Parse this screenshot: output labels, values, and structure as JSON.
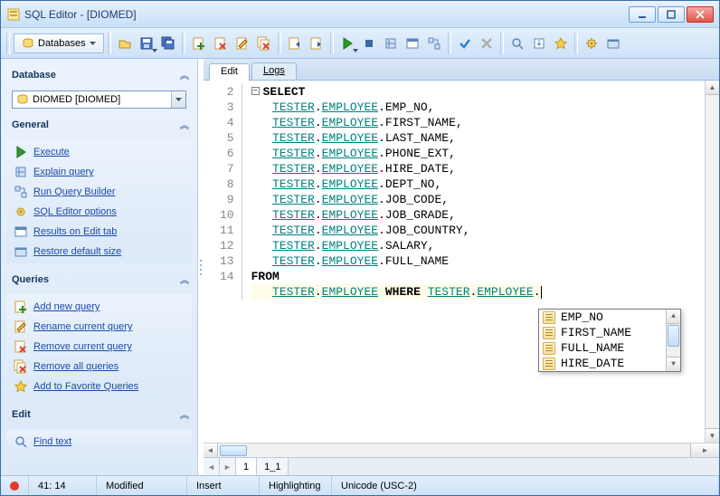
{
  "window": {
    "title": "SQL Editor - [DIOMED]"
  },
  "toolbar": {
    "databases_label": "Databases"
  },
  "sidebar": {
    "database_header": "Database",
    "db_value": "DIOMED [DIOMED]",
    "general_header": "General",
    "general": {
      "execute": "Execute",
      "explain": "Explain query",
      "builder": "Run Query Builder",
      "options": "SQL Editor options",
      "results": "Results on Edit tab",
      "restore": "Restore default size"
    },
    "queries_header": "Queries",
    "queries": {
      "add": "Add new query",
      "rename": "Rename current query",
      "remove": "Remove current query",
      "remove_all": "Remove all queries",
      "fav": "Add to Favorite Queries"
    },
    "edit_header": "Edit",
    "edit": {
      "find": "Find text"
    }
  },
  "tabs": {
    "edit": "Edit",
    "logs": "Logs"
  },
  "code": {
    "kw_select": "SELECT",
    "kw_from": "FROM",
    "kw_where": "WHERE",
    "schema": "TESTER",
    "table": "EMPLOYEE",
    "cols": [
      "EMP_NO",
      "FIRST_NAME",
      "LAST_NAME",
      "PHONE_EXT",
      "HIRE_DATE",
      "DEPT_NO",
      "JOB_CODE",
      "JOB_GRADE",
      "JOB_COUNTRY",
      "SALARY",
      "FULL_NAME"
    ],
    "line_numbers": [
      "",
      "2",
      "3",
      "4",
      "5",
      "6",
      "7",
      "8",
      "9",
      "10",
      "11",
      "12",
      "13",
      "14"
    ]
  },
  "autocomplete": [
    "EMP_NO",
    "FIRST_NAME",
    "FULL_NAME",
    "HIRE_DATE"
  ],
  "bottom_tabs": {
    "t1": "1",
    "t2": "1_1"
  },
  "status": {
    "pos": "41:  14",
    "modified": "Modified",
    "insert": "Insert",
    "highlight": "Highlighting",
    "encoding": "Unicode (USC-2)"
  }
}
